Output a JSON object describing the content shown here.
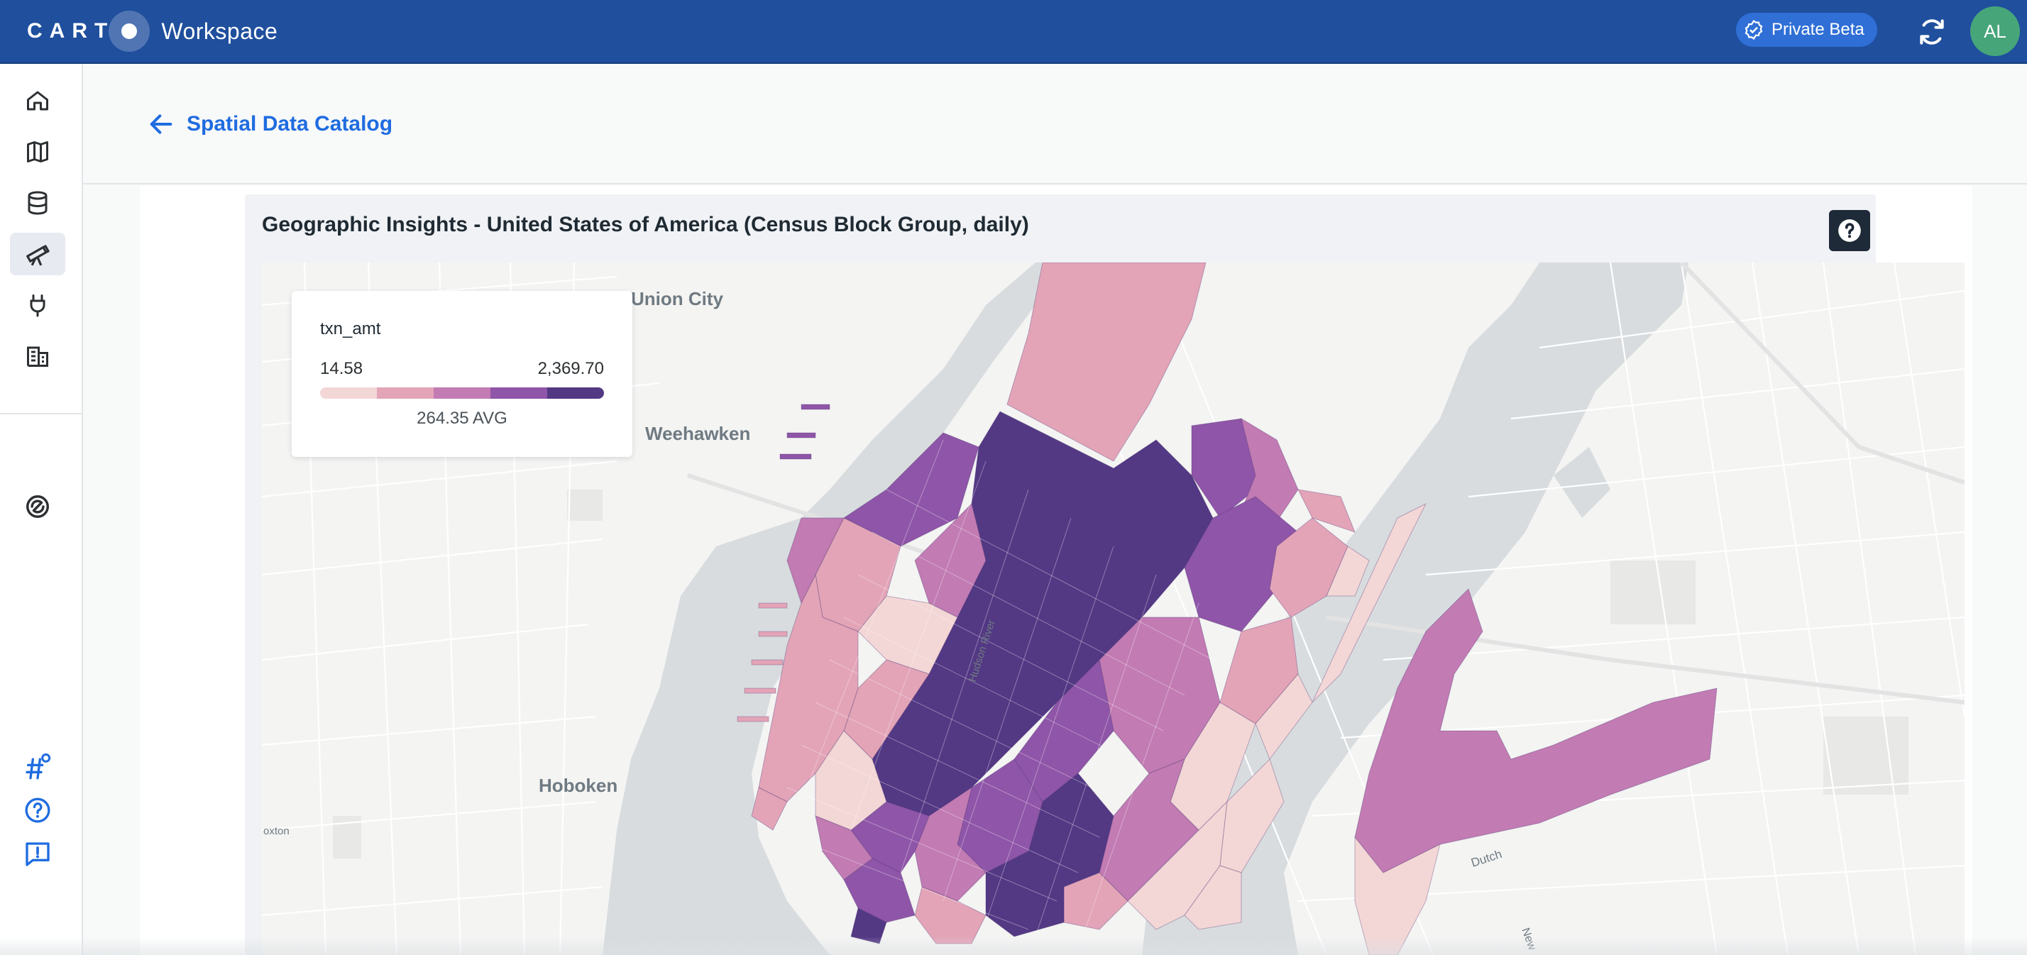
{
  "brand": {
    "logo_text": "CART",
    "product": "Workspace"
  },
  "topbar": {
    "beta_label": "Private Beta",
    "avatar_initials": "AL"
  },
  "sidebar": {
    "items": [
      {
        "icon": "home-icon",
        "active": false
      },
      {
        "icon": "map-icon",
        "active": false
      },
      {
        "icon": "database-icon",
        "active": false
      },
      {
        "icon": "telescope-icon",
        "active": true
      },
      {
        "icon": "plug-icon",
        "active": false
      },
      {
        "icon": "building-table-icon",
        "active": false
      },
      {
        "icon": "api-dial-icon",
        "active": false
      }
    ],
    "footer_icons": [
      "hashtag-settings-icon",
      "help-circle-icon",
      "feedback-icon"
    ]
  },
  "header": {
    "back_label": "Spatial Data Catalog"
  },
  "card": {
    "title": "Geographic Insights - United States of America (Census Block Group, daily)"
  },
  "map": {
    "place_labels": [
      "Union City",
      "Weehawken",
      "Hoboken",
      "Hudson River",
      "Dutch",
      "oxton",
      "New"
    ],
    "colors": {
      "base": "#f4f4f3",
      "water": "#d8dcdf",
      "road": "#ffffff",
      "ramp": [
        "#f3d6d6",
        "#e3a4b8",
        "#c27bb3",
        "#8f55a8",
        "#533884"
      ]
    }
  },
  "legend": {
    "variable": "txn_amt",
    "min": "14.58",
    "max": "2,369.70",
    "avg": "264.35 AVG"
  },
  "colors": {
    "topbar": "#1f4f9d",
    "accent": "#1f6ce0",
    "avatar": "#47a57a"
  }
}
